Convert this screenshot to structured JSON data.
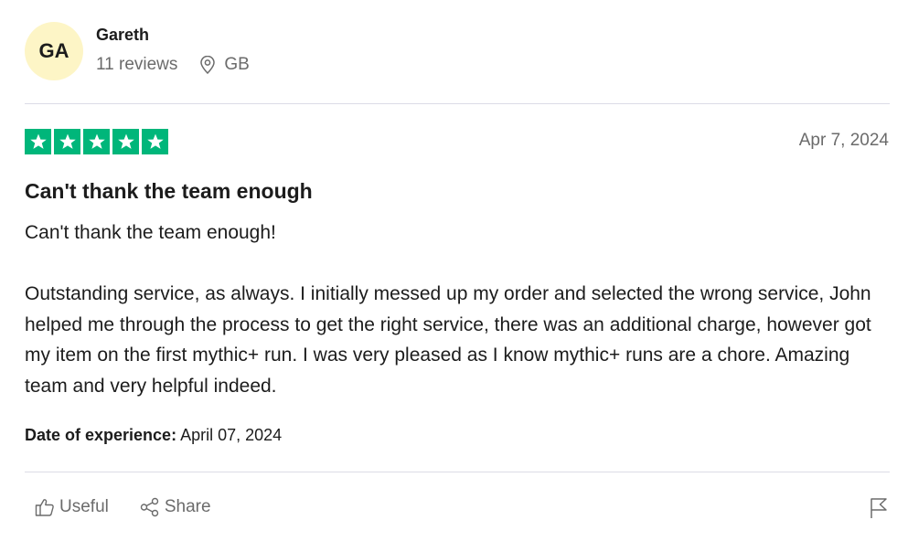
{
  "reviewer": {
    "initials": "GA",
    "name": "Gareth",
    "reviews_count": "11 reviews",
    "location": "GB",
    "avatar_color": "#fdf5c6"
  },
  "review": {
    "rating": 5,
    "max_rating": 5,
    "star_color": "#00b67a",
    "date": "Apr 7, 2024",
    "title": "Can't thank the team enough",
    "body": "Can't thank the team enough!\n\nOutstanding service, as always. I initially messed up my order and selected the wrong service, John helped me through the process to get the right service, there was an additional charge, however got my item on the first mythic+ run. I was very pleased as I know mythic+ runs are a chore. Amazing team and very helpful indeed.",
    "experience_label": "Date of experience:",
    "experience_date": "April 07, 2024"
  },
  "actions": {
    "useful_label": "Useful",
    "share_label": "Share",
    "useful_icon": "thumbs-up-icon",
    "share_icon": "share-icon",
    "report_icon": "flag-icon"
  }
}
